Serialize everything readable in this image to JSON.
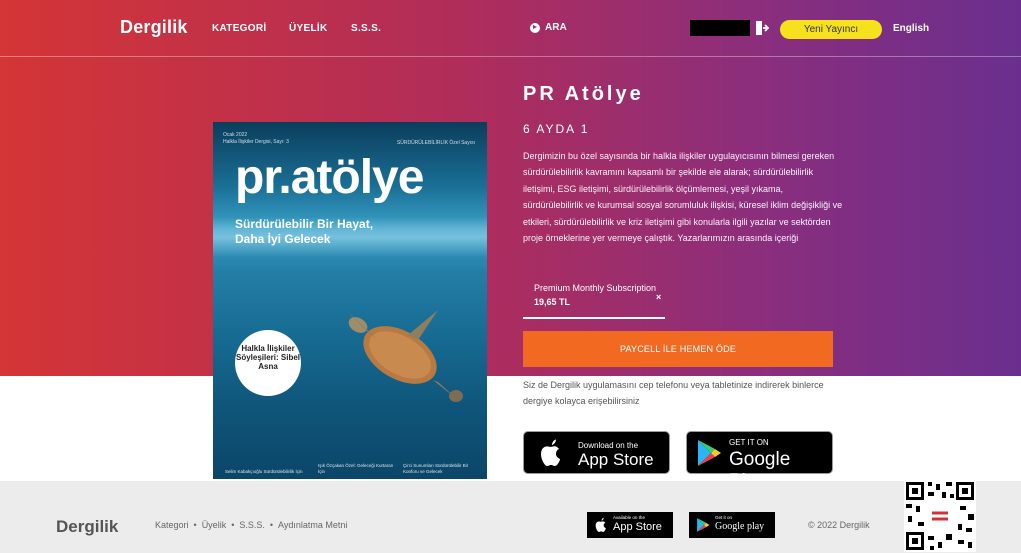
{
  "header": {
    "logo": "Dergilik",
    "nav": [
      "KATEGORİ",
      "ÜYELİK",
      "S.S.S."
    ],
    "search_label": "ARA",
    "new_publisher": "Yeni Yayıncı",
    "language": "English"
  },
  "cover": {
    "meta_date": "Ocak 2022",
    "meta_issue": "Halkla İlişkiler Dergisi, Sayı: 3",
    "meta_right": "SÜRDÜRÜLEBİLİRLİK Özel Sayısı",
    "masthead": "pr.atölye",
    "tagline": "Sürdürülebilir Bir Hayat, Daha İyi Gelecek",
    "badge": "Halkla İlişkiler Söyleşileri: Sibel Asna",
    "foot1": "Selim Kabakçıoğlu Sürdürülebilirlik İçin",
    "foot2": "Işık Özçakan Özel: Geleceği Kurtaran İçin",
    "foot3": "Çirci Sunumları Sürdürülebilir Bir Konforu ve Gelecek"
  },
  "product": {
    "title": "PR Atölye",
    "frequency": "6 AYDA 1",
    "description": "Dergimizin bu özel sayısında bir halkla ilişkiler uygulayıcısının bilmesi gereken sürdürülebilirlik kavramını kapsamlı bir şekilde ele alarak; sürdürülebilirlik iletişimi, ESG iletişimi, sürdürülebilirlik ölçümlemesi, yeşil yıkama, sürdürülebilirlik ve kurumsal sosyal sorumluluk ilişkisi, küresel iklim değişikliği ve etkileri, sürdürülebilirlik ve kriz iletişimi gibi konularla ilgili yazılar ve sektörden proje örneklerine yer vermeye çalıştık. Yazarlarımızın arasında içeriği"
  },
  "subscription": {
    "name": "Premium Monthly Subscription",
    "price": "19,65 TL",
    "close": "×"
  },
  "pay_button": "PAYCELL İLE HEMEN ÖDE",
  "app_note": "Siz de Dergilik uygulamasını cep telefonu veya tabletinize indirerek binlerce dergiye kolayca erişebilirsiniz",
  "stores": {
    "apple_small": "Download on the",
    "apple_big": "App Store",
    "google_small": "GET IT ON",
    "google_big": "Google Play"
  },
  "footer": {
    "logo": "Dergilik",
    "links": [
      "Kategori",
      "Üyelik",
      "S.S.S.",
      "Aydınlatma Metni"
    ],
    "separator": "•",
    "apple_small": "Available on the",
    "apple_big": "App Store",
    "google_small": "Get it on",
    "google_big": "Google play",
    "copyright": "© 2022 Dergilik"
  },
  "colors": {
    "gradient_start": "#d43535",
    "gradient_end": "#6a2f8e",
    "accent_yellow": "#f5e21c",
    "pay_orange": "#f26a22",
    "footer_bg": "#ececec"
  },
  "icons": [
    "play-circle-icon",
    "logout-icon",
    "apple-icon",
    "google-play-icon",
    "qr-code"
  ]
}
